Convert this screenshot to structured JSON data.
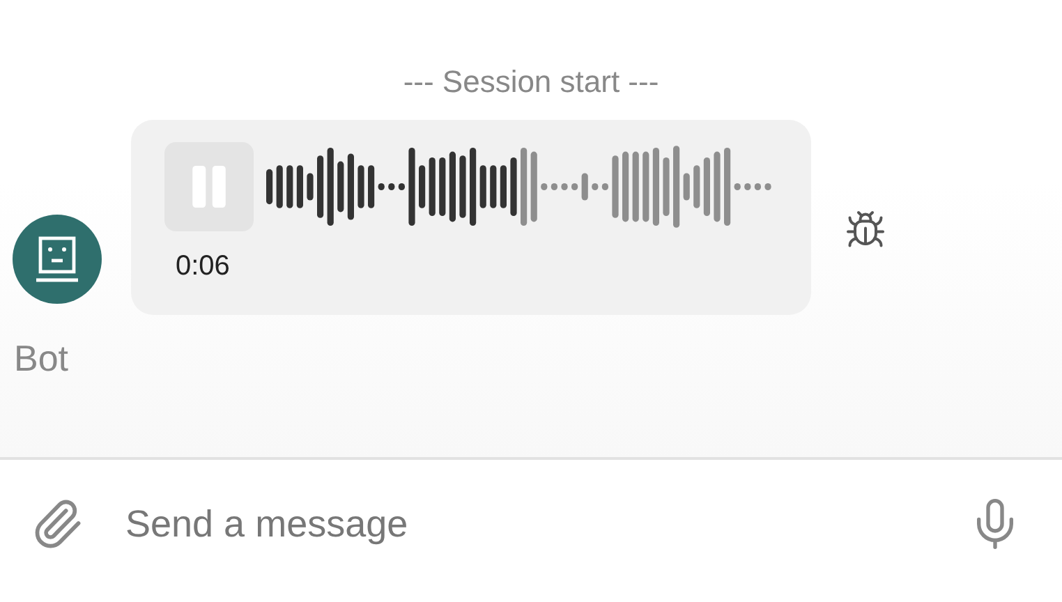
{
  "session_marker": "--- Session start ---",
  "message": {
    "sender": "Bot",
    "playing": true,
    "duration": "0:06"
  },
  "composer": {
    "placeholder": "Send a message"
  }
}
